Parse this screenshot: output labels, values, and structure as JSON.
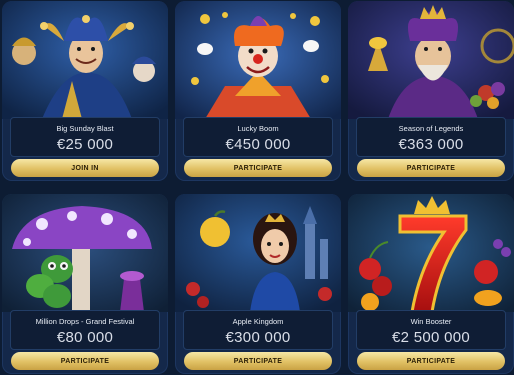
{
  "tournaments": [
    {
      "title": "Big Sunday Blast",
      "prize": "€25 000",
      "button": "JOIN IN"
    },
    {
      "title": "Lucky Boom",
      "prize": "€450 000",
      "button": "PARTICIPATE"
    },
    {
      "title": "Season of Legends",
      "prize": "€363 000",
      "button": "PARTICIPATE"
    },
    {
      "title": "Million Drops - Grand Festival",
      "prize": "€80 000",
      "button": "PARTICIPATE"
    },
    {
      "title": "Apple Kingdom",
      "prize": "€300 000",
      "button": "PARTICIPATE"
    },
    {
      "title": "Win Booster",
      "prize": "€2 500 000",
      "button": "PARTICIPATE"
    }
  ],
  "colors": {
    "page_bg": "#0d1c33",
    "card_bg": "#14284a",
    "button_gold": "#e1c164"
  }
}
